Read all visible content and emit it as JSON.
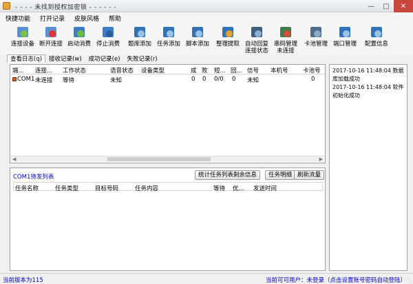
{
  "window": {
    "title": "- - - - 未找到授权加密锁 - - - - - -"
  },
  "menu": [
    "快捷功能",
    "打开记录",
    "皮肤风格",
    "帮助"
  ],
  "toolbar": [
    {
      "label": "连接设备",
      "icon": "connect-device-icon"
    },
    {
      "label": "断开连接",
      "icon": "disconnect-icon"
    },
    {
      "label": "启动消费",
      "icon": "start-consume-icon"
    },
    {
      "label": "停止消费",
      "icon": "stop-consume-icon"
    },
    {
      "label": "题库添加",
      "icon": "question-bank-icon"
    },
    {
      "label": "任务添加",
      "icon": "task-add-icon"
    },
    {
      "label": "脚本添加",
      "icon": "script-add-icon"
    },
    {
      "label": "整理提取",
      "icon": "organize-icon"
    },
    {
      "label": "自动回复",
      "label2": "连接状态",
      "icon": "auto-reply-icon"
    },
    {
      "label": "串码管理",
      "label2": "未连接",
      "icon": "serial-manage-icon"
    },
    {
      "label": "卡池管理",
      "icon": "card-pool-icon"
    },
    {
      "label": "端口管理",
      "icon": "port-manage-icon"
    },
    {
      "label": "配置信息",
      "icon": "config-info-icon"
    }
  ],
  "tabs": [
    "查看日志(q)",
    "接收记录(w)",
    "成功记录(e)",
    "失败记录(r)"
  ],
  "device_table": {
    "headers": [
      "端...",
      "连接...",
      "工作状态",
      "语音状态",
      "设备类型",
      "成",
      "败",
      "短...",
      "回...",
      "信号",
      "本机号",
      "卡池号"
    ],
    "rows": [
      [
        "COM1",
        "未连接",
        "等待",
        "未知",
        "",
        "0",
        "0",
        "0/0",
        "0",
        "未知",
        "",
        "0"
      ]
    ]
  },
  "log": [
    "2017-10-16 11:48:04 数据库加载成功",
    "2017-10-16 11:48:04 软件初始化成功"
  ],
  "queue": {
    "title": "COM1待发列表",
    "buttons": [
      "统计任务列表剩余信息",
      "任务明细",
      "刷新流量"
    ],
    "headers": [
      "任务名称",
      "任务类型",
      "目标号码",
      "任务内容",
      "等待",
      "优...",
      "发送时间"
    ]
  },
  "status": {
    "version": "当前版本为115",
    "user": "当前可可用户：未登录（点击设置账号密码自动登陆）"
  },
  "colors": {
    "accent": "#0000c8",
    "close": "#c9463d"
  }
}
